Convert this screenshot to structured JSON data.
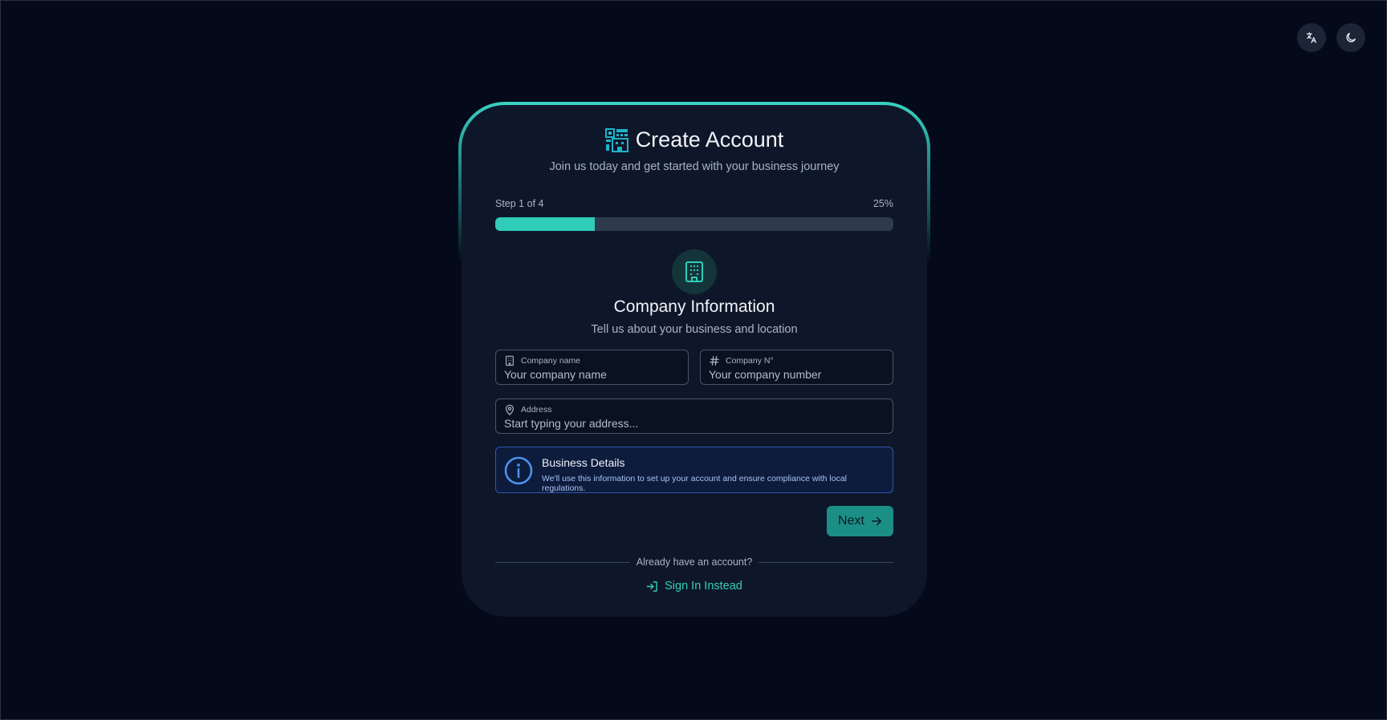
{
  "header": {
    "language_button_icon": "translate-icon",
    "theme_button_icon": "moon-icon"
  },
  "card": {
    "logo_icon": "qr-building-logo-icon",
    "title": "Create Account",
    "subtitle": "Join us today and get started with your business journey"
  },
  "progress": {
    "step_label": "Step 1 of 4",
    "percent_label": "25%",
    "fraction": 0.25
  },
  "section": {
    "icon": "building-icon",
    "title": "Company Information",
    "subtitle": "Tell us about your business and location"
  },
  "form": {
    "company_name": {
      "label": "Company name",
      "placeholder": "Your company name",
      "value": ""
    },
    "company_number": {
      "label": "Company N°",
      "placeholder": "Your company number",
      "value": ""
    },
    "address": {
      "label": "Address",
      "placeholder": "Start typing your address...",
      "value": ""
    }
  },
  "info": {
    "title": "Business Details",
    "text": "We'll use this information to set up your account and ensure compliance with local regulations."
  },
  "actions": {
    "next_label": "Next"
  },
  "footer": {
    "prompt": "Already have an account?",
    "signin_label": "Sign In Instead"
  },
  "colors": {
    "accent": "#2fcdb8",
    "background": "#040a1a",
    "card": "#0e1729",
    "info_border": "#2f58b0",
    "next_button": "#1b8f86"
  }
}
